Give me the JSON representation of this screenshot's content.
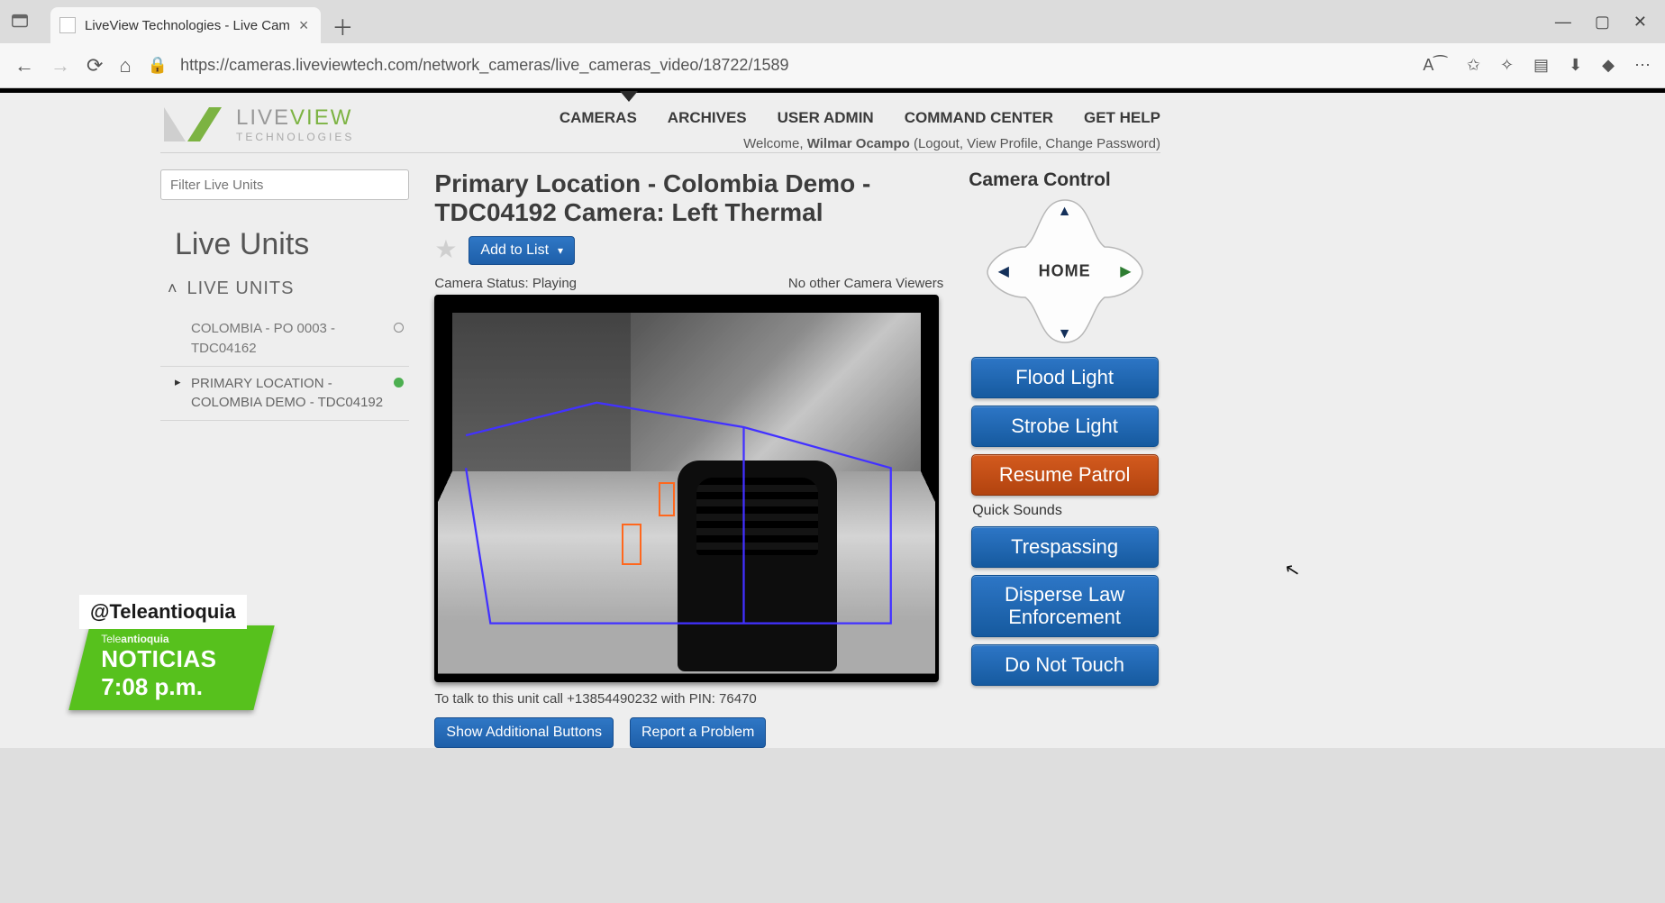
{
  "browser": {
    "tab_title": "LiveView Technologies - Live Cam",
    "url": "https://cameras.liveviewtech.com/network_cameras/live_cameras_video/18722/1589"
  },
  "header": {
    "brand_live": "LIVE",
    "brand_view": "VIEW",
    "brand_sub": "TECHNOLOGIES",
    "nav": [
      "CAMERAS",
      "ARCHIVES",
      "USER ADMIN",
      "COMMAND CENTER",
      "GET HELP"
    ],
    "welcome_prefix": "Welcome, ",
    "welcome_user": "Wilmar Ocampo",
    "welcome_links": " (Logout, View Profile, Change Password)"
  },
  "sidebar": {
    "filter_placeholder": "Filter Live Units",
    "heading": "Live Units",
    "section_label": "LIVE UNITS",
    "items": [
      {
        "label": "COLOMBIA - PO 0003 - TDC04162",
        "active": false,
        "online": false
      },
      {
        "label": "PRIMARY LOCATION - COLOMBIA DEMO - TDC04192",
        "active": true,
        "online": true
      }
    ]
  },
  "main": {
    "title": "Primary Location - Colombia Demo - TDC04192 Camera: Left Thermal",
    "add_to_list": "Add to List",
    "status_label": "Camera Status:",
    "status_value": "Playing",
    "viewers_text": "No other Camera Viewers",
    "talk_line": "To talk to this unit call +13854490232 with PIN: 76470",
    "btn_show_additional": "Show Additional Buttons",
    "btn_report": "Report a Problem"
  },
  "control": {
    "title": "Camera Control",
    "home": "HOME",
    "buttons_primary": [
      "Flood Light",
      "Strobe Light",
      "Resume Patrol"
    ],
    "quick_sounds_label": "Quick Sounds",
    "buttons_sounds": [
      "Trespassing",
      "Disperse Law Enforcement",
      "Do Not Touch"
    ]
  },
  "watermark": {
    "handle": "@Teleantioquia",
    "line1_pre": "Tele",
    "line1_bold": "antioquia",
    "line2": "NOTICIAS",
    "time": "7:08 p.m."
  }
}
